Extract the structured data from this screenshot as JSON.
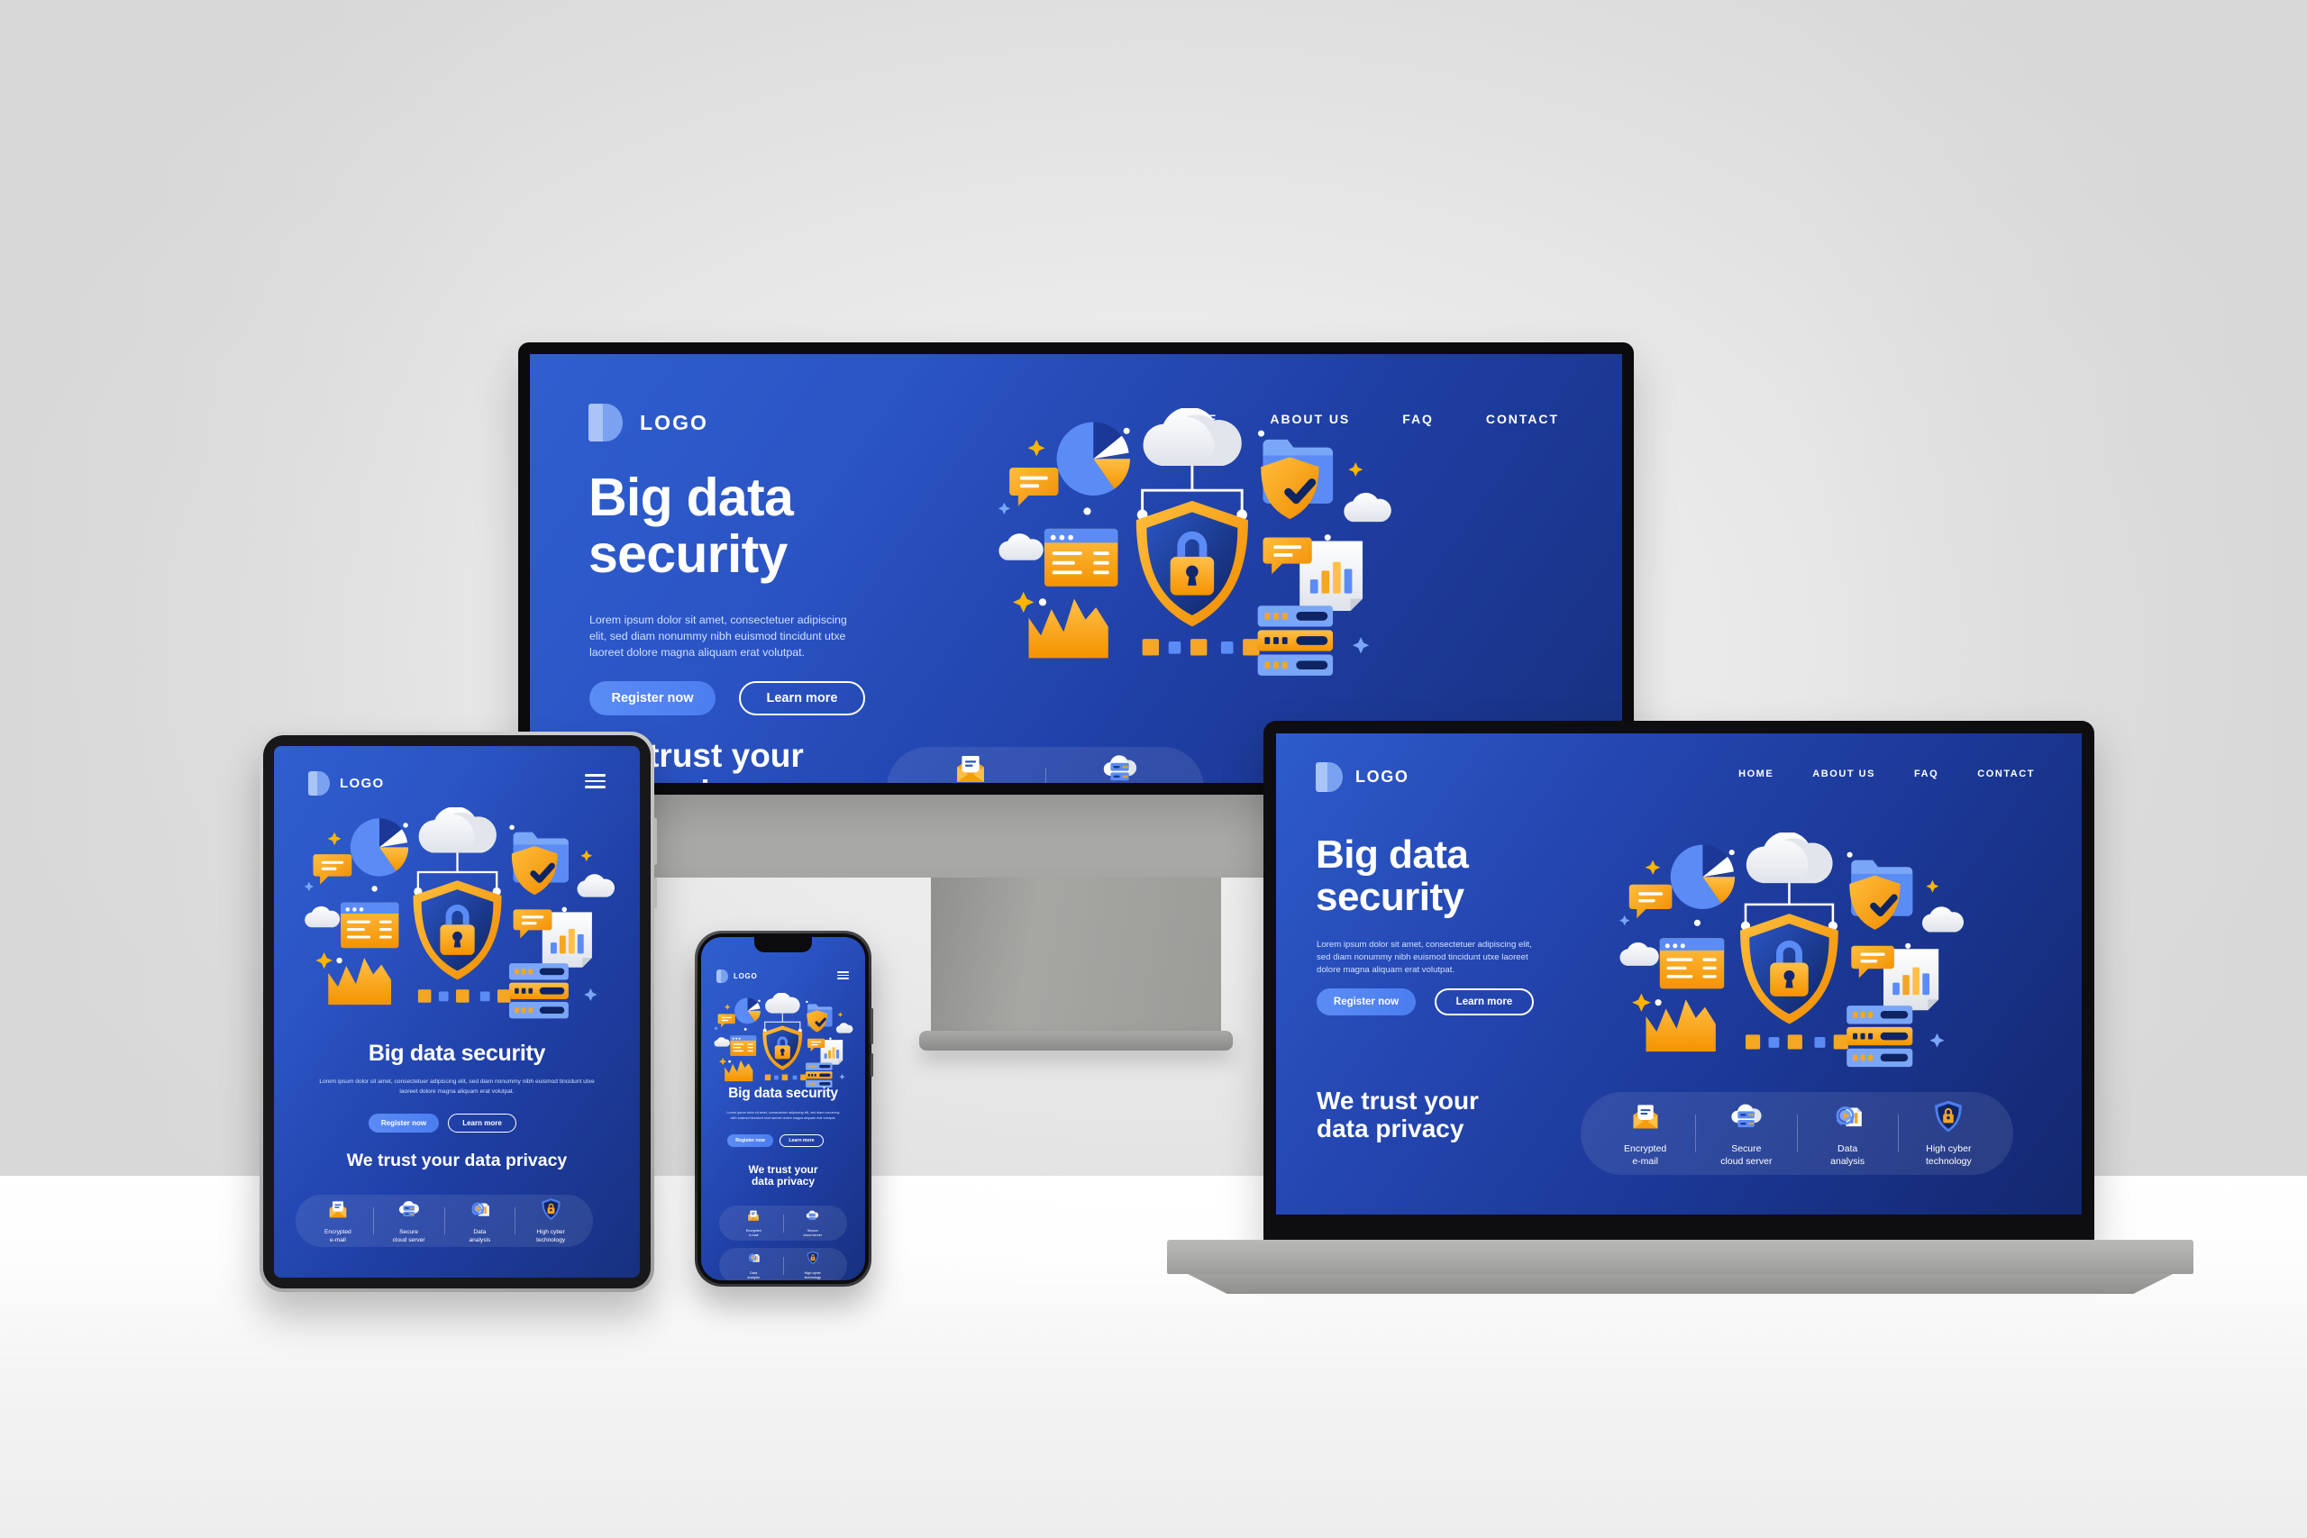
{
  "brand": {
    "logo_text": "LOGO",
    "logo_mark": "d-letter-logo"
  },
  "colors": {
    "screen_blue_light": "#2f5fd0",
    "screen_blue_dark": "#17307f",
    "accent_orange": "#f9a825",
    "accent_blue": "#5b8cf5",
    "text_light": "#cfe0ff",
    "device_gray": "#a8a8a5",
    "bezel_black": "#0b0b0d"
  },
  "nav": {
    "items": [
      {
        "label": "HOME"
      },
      {
        "label": "ABOUT US"
      },
      {
        "label": "FAQ"
      },
      {
        "label": "CONTACT"
      }
    ],
    "mobile_icon": "hamburger-menu-icon"
  },
  "hero": {
    "title_line1": "Big data",
    "title_line2": "security",
    "title_single": "Big data security",
    "paragraph": "Lorem ipsum dolor sit amet, consectetuer adipiscing elit, sed diam nonummy nibh euismod tincidunt utxe laoreet dolore magna aliquam erat volutpat.",
    "buttons": {
      "primary": "Register now",
      "secondary": "Learn more"
    }
  },
  "trust": {
    "title_line1": "We trust your",
    "title_line2": "data privacy",
    "title_single": "We trust your data privacy"
  },
  "features": [
    {
      "icon": "encrypted-email-icon",
      "line1": "Encrypted",
      "line2": "e-mail"
    },
    {
      "icon": "secure-cloud-server-icon",
      "line1": "Secure",
      "line2": "cloud server"
    },
    {
      "icon": "data-analysis-icon",
      "line1": "Data",
      "line2": "analysis"
    },
    {
      "icon": "high-cyber-technology-icon",
      "line1": "High cyber",
      "line2": "technology"
    }
  ],
  "devices": [
    {
      "name": "desktop-monitor",
      "features_shown": 2
    },
    {
      "name": "tablet",
      "features_shown": 4
    },
    {
      "name": "smartphone",
      "features_shown": 4
    },
    {
      "name": "laptop",
      "features_shown": 4
    }
  ],
  "illustration": {
    "name": "big-data-security-illustration",
    "elements": [
      "pie-chart",
      "cloud",
      "folder-shield-check",
      "chat-bubble",
      "browser-window",
      "area-chart",
      "central-lock-shield",
      "bar-chart-document",
      "server-stack",
      "sparkles"
    ]
  }
}
